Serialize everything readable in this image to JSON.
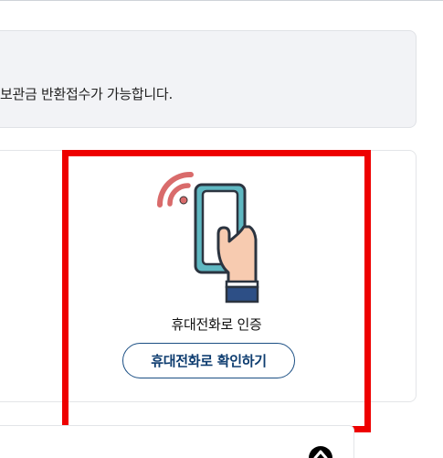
{
  "notice": {
    "text": "보관금 반환접수가 가능합니다."
  },
  "auth": {
    "title": "휴대전화로 인증",
    "button_label": "휴대전화로 확인하기",
    "illustration_icon": "phone-hand-signal-icon"
  },
  "scroll_top": {
    "icon": "chevron-up-icon"
  },
  "colors": {
    "highlight": "#ee0000",
    "button_border": "#1b4f84",
    "button_text": "#0e3d70",
    "notice_bg": "#f2f3f6",
    "signal": "#d96b6b",
    "phone_screen": "#5fb8c2"
  }
}
